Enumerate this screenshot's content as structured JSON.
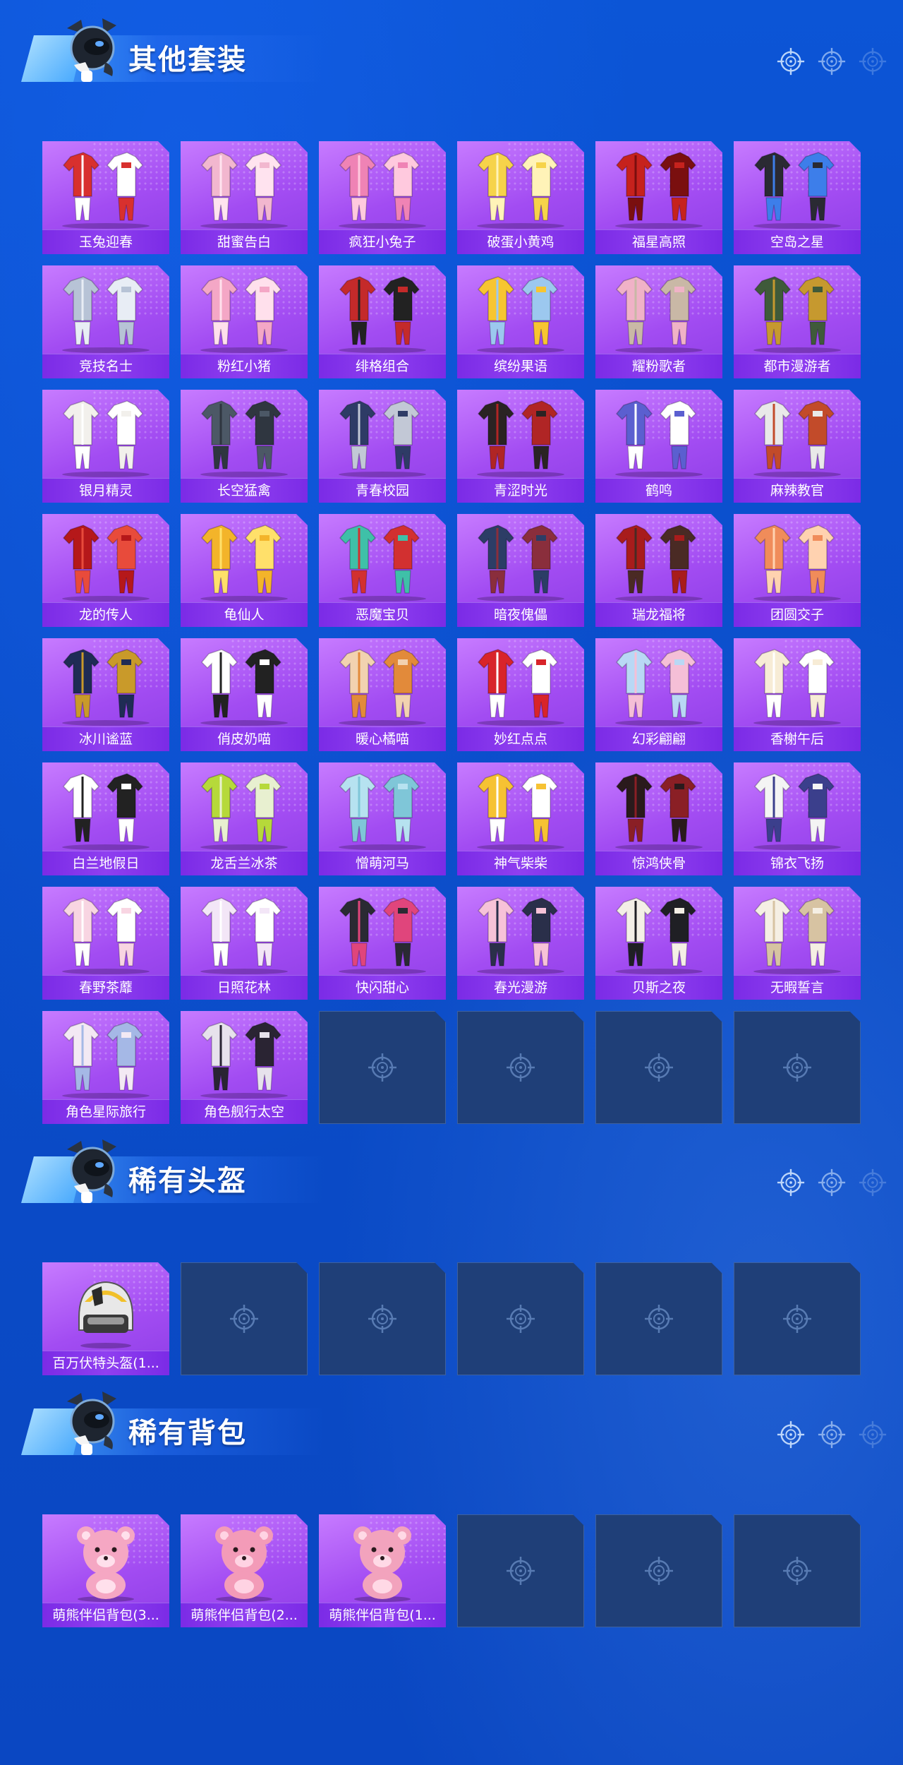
{
  "sections": [
    {
      "title": "其他套装",
      "items": [
        {
          "label": "玉兔迎春",
          "c1": "#d8302e",
          "c2": "#ffffff"
        },
        {
          "label": "甜蜜告白",
          "c1": "#f2b7cf",
          "c2": "#ffe3ef"
        },
        {
          "label": "疯狂小兔子",
          "c1": "#ef83b5",
          "c2": "#ffc9de"
        },
        {
          "label": "破蛋小黄鸡",
          "c1": "#f6d34a",
          "c2": "#fff3b8"
        },
        {
          "label": "福星高照",
          "c1": "#c6221d",
          "c2": "#7a0f0f"
        },
        {
          "label": "空岛之星",
          "c1": "#2a2a33",
          "c2": "#3d7eea"
        },
        {
          "label": "竞技名士",
          "c1": "#b7c3d6",
          "c2": "#e8edf5"
        },
        {
          "label": "粉红小猪",
          "c1": "#f4a7c6",
          "c2": "#ffe0ec"
        },
        {
          "label": "绯格组合",
          "c1": "#c42a2a",
          "c2": "#222222"
        },
        {
          "label": "缤纷果语",
          "c1": "#f7c531",
          "c2": "#9cc8ef"
        },
        {
          "label": "耀粉歌者",
          "c1": "#f0b2c7",
          "c2": "#c9b8a6"
        },
        {
          "label": "都市漫游者",
          "c1": "#3f5a3a",
          "c2": "#c6992f"
        },
        {
          "label": "银月精灵",
          "c1": "#f2f0ec",
          "c2": "#ffffff"
        },
        {
          "label": "长空猛禽",
          "c1": "#4c5866",
          "c2": "#2f3640"
        },
        {
          "label": "青春校园",
          "c1": "#2e3b66",
          "c2": "#c2c8d6"
        },
        {
          "label": "青涩时光",
          "c1": "#2a2323",
          "c2": "#b02525"
        },
        {
          "label": "鹤鸣",
          "c1": "#5b5fd0",
          "c2": "#ffffff"
        },
        {
          "label": "麻辣教官",
          "c1": "#e9e9e9",
          "c2": "#c24b2a"
        },
        {
          "label": "龙的传人",
          "c1": "#b5181a",
          "c2": "#e84b3b"
        },
        {
          "label": "龟仙人",
          "c1": "#f3b42a",
          "c2": "#ffe06a"
        },
        {
          "label": "恶魔宝贝",
          "c1": "#3fc0a8",
          "c2": "#d23030"
        },
        {
          "label": "暗夜傀儡",
          "c1": "#2c3d66",
          "c2": "#8a2e3c"
        },
        {
          "label": "瑞龙福将",
          "c1": "#a81c1c",
          "c2": "#4a2a24"
        },
        {
          "label": "团圆交子",
          "c1": "#f08c5a",
          "c2": "#ffd2b0"
        },
        {
          "label": "冰川谧蓝",
          "c1": "#1f2c55",
          "c2": "#c99a2a"
        },
        {
          "label": "俏皮奶喵",
          "c1": "#ffffff",
          "c2": "#222222"
        },
        {
          "label": "暖心橘喵",
          "c1": "#f2d2b0",
          "c2": "#e28a3a"
        },
        {
          "label": "妙红点点",
          "c1": "#d8242a",
          "c2": "#ffffff"
        },
        {
          "label": "幻彩翩翩",
          "c1": "#b9d8f5",
          "c2": "#f5bfd7"
        },
        {
          "label": "香榭午后",
          "c1": "#f7ecd6",
          "c2": "#ffffff"
        },
        {
          "label": "白兰地假日",
          "c1": "#ffffff",
          "c2": "#222222"
        },
        {
          "label": "龙舌兰冰茶",
          "c1": "#b6d93a",
          "c2": "#e8f0d0"
        },
        {
          "label": "憎萌河马",
          "c1": "#b6e2f0",
          "c2": "#7fc6d8"
        },
        {
          "label": "神气柴柴",
          "c1": "#f6c233",
          "c2": "#ffffff"
        },
        {
          "label": "惊鸿侠骨",
          "c1": "#2a1a1c",
          "c2": "#8a1f25"
        },
        {
          "label": "锦衣飞扬",
          "c1": "#f4f4f4",
          "c2": "#3b3f8c"
        },
        {
          "label": "春野茶蘼",
          "c1": "#f8d5e2",
          "c2": "#ffffff"
        },
        {
          "label": "日照花林",
          "c1": "#f3e6f7",
          "c2": "#ffffff"
        },
        {
          "label": "快闪甜心",
          "c1": "#2a2a33",
          "c2": "#e0457c"
        },
        {
          "label": "春光漫游",
          "c1": "#f7c2d8",
          "c2": "#2a2f4a"
        },
        {
          "label": "贝斯之夜",
          "c1": "#f4efe6",
          "c2": "#1f1f24"
        },
        {
          "label": "无暇誓言",
          "c1": "#f5efe4",
          "c2": "#d7c3a2"
        },
        {
          "label": "角色星际旅行",
          "c1": "#f3e9f4",
          "c2": "#a5b8e6"
        },
        {
          "label": "角色舰行太空",
          "c1": "#e7e2ec",
          "c2": "#2a2433"
        }
      ],
      "empty_count": 4
    },
    {
      "title": "稀有头盔",
      "items": [
        {
          "label": "百万伏特头盔(1...",
          "c1": "#e8e8e8",
          "c2": "#f1c02a",
          "kind": "helmet"
        }
      ],
      "empty_count": 5
    },
    {
      "title": "稀有背包",
      "items": [
        {
          "label": "萌熊伴侣背包(3...",
          "c1": "#f5a7c3",
          "c2": "#ffe0ec",
          "kind": "bear"
        },
        {
          "label": "萌熊伴侣背包(2...",
          "c1": "#f39bb8",
          "c2": "#ffd3e3",
          "kind": "bear"
        },
        {
          "label": "萌熊伴侣背包(1...",
          "c1": "#f2a3bd",
          "c2": "#ffd9e6",
          "kind": "bear"
        }
      ],
      "empty_count": 3
    }
  ],
  "icons": {
    "mascot": "mascot-icon",
    "reticle": "crosshair-icon"
  }
}
